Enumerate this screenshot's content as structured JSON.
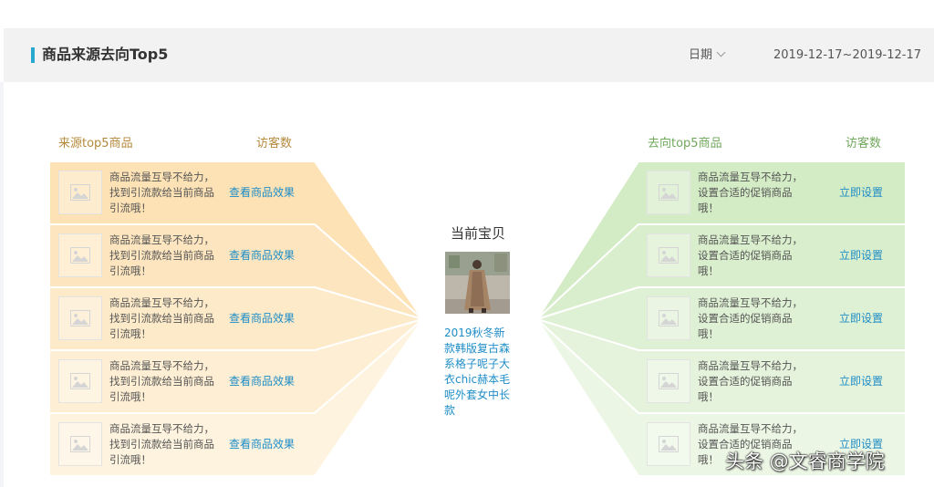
{
  "header": {
    "title": "商品来源去向Top5",
    "date_label": "日期",
    "date_range": "2019-12-17~2019-12-17"
  },
  "source": {
    "heading": "来源top5商品",
    "metric": "访客数",
    "rows": [
      {
        "line1": "商品流量互导不给力，",
        "line2": "找到引流款给当前商品",
        "line3": "引流哦！",
        "link": "查看商品效果"
      },
      {
        "line1": "商品流量互导不给力，",
        "line2": "找到引流款给当前商品",
        "line3": "引流哦！",
        "link": "查看商品效果"
      },
      {
        "line1": "商品流量互导不给力，",
        "line2": "找到引流款给当前商品",
        "line3": "引流哦！",
        "link": "查看商品效果"
      },
      {
        "line1": "商品流量互导不给力，",
        "line2": "找到引流款给当前商品",
        "line3": "引流哦！",
        "link": "查看商品效果"
      },
      {
        "line1": "商品流量互导不给力，",
        "line2": "找到引流款给当前商品",
        "line3": "引流哦！",
        "link": "查看商品效果"
      }
    ]
  },
  "destination": {
    "heading": "去向top5商品",
    "metric": "访客数",
    "rows": [
      {
        "line1": "商品流量互导不给力，",
        "line2": "设置合适的促销商品",
        "line3": "哦！",
        "link": "立即设置"
      },
      {
        "line1": "商品流量互导不给力，",
        "line2": "设置合适的促销商品",
        "line3": "哦！",
        "link": "立即设置"
      },
      {
        "line1": "商品流量互导不给力，",
        "line2": "设置合适的促销商品",
        "line3": "哦！",
        "link": "立即设置"
      },
      {
        "line1": "商品流量互导不给力，",
        "line2": "设置合适的促销商品",
        "line3": "哦！",
        "link": "立即设置"
      },
      {
        "line1": "商品流量互导不给力，",
        "line2": "设置合适的促销商品",
        "line3": "哦！",
        "link": "立即设置"
      }
    ]
  },
  "current_product": {
    "title": "当前宝贝",
    "name": "2019秋冬新款韩版复古森系格子呢子大衣chic赫本毛呢外套女中长款"
  },
  "watermark": "头条 @文睿商学院",
  "colors": {
    "accent": "#27a9cf",
    "source_bands": [
      "#fde2b6",
      "#fde6bf",
      "#fdeac9",
      "#feeed3",
      "#fef3de"
    ],
    "destination_bands": [
      "#d3ecc5",
      "#d9eecc",
      "#dff1d4",
      "#e5f3dc",
      "#ebf6e4"
    ],
    "link": "#1f8dc7"
  },
  "icons": {
    "thumbnail_placeholder": "image-placeholder-icon",
    "date_dropdown": "chevron-down-icon"
  }
}
